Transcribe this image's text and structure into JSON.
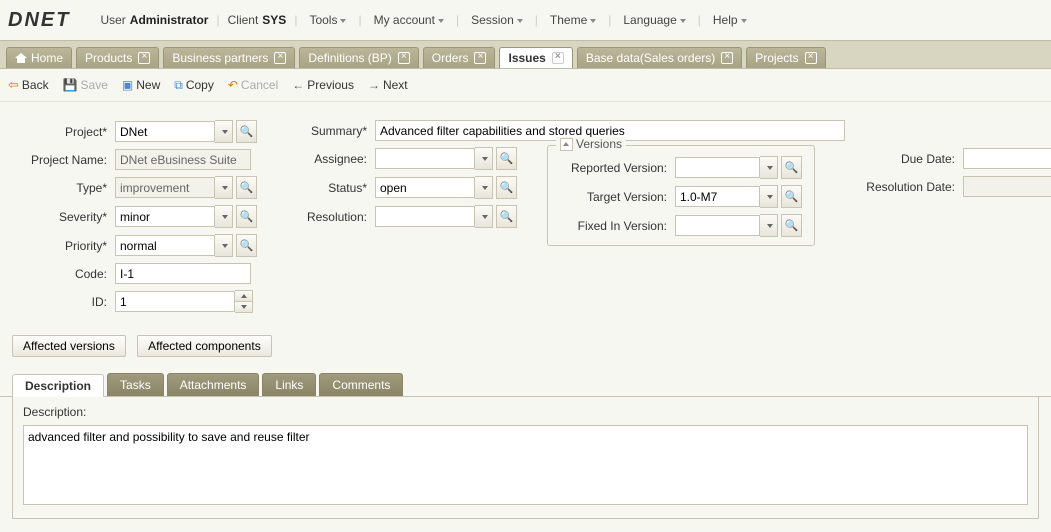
{
  "header": {
    "logo": "DNET",
    "user_label": "User",
    "user_value": "Administrator",
    "client_label": "Client",
    "client_value": "SYS",
    "menus": [
      "Tools",
      "My account",
      "Session",
      "Theme",
      "Language",
      "Help"
    ]
  },
  "main_tabs": [
    {
      "label": "Home",
      "closable": false,
      "active": false
    },
    {
      "label": "Products",
      "closable": true,
      "active": false
    },
    {
      "label": "Business partners",
      "closable": true,
      "active": false
    },
    {
      "label": "Definitions (BP)",
      "closable": true,
      "active": false
    },
    {
      "label": "Orders",
      "closable": true,
      "active": false
    },
    {
      "label": "Issues",
      "closable": true,
      "active": true
    },
    {
      "label": "Base data(Sales orders)",
      "closable": true,
      "active": false
    },
    {
      "label": "Projects",
      "closable": true,
      "active": false
    }
  ],
  "toolbar": {
    "back": "Back",
    "save": "Save",
    "new": "New",
    "copy": "Copy",
    "cancel": "Cancel",
    "previous": "Previous",
    "next": "Next"
  },
  "form": {
    "project_label": "Project*",
    "project_value": "DNet",
    "project_name_label": "Project Name:",
    "project_name_value": "DNet eBusiness Suite",
    "type_label": "Type*",
    "type_value": "improvement",
    "severity_label": "Severity*",
    "severity_value": "minor",
    "priority_label": "Priority*",
    "priority_value": "normal",
    "code_label": "Code:",
    "code_value": "I-1",
    "id_label": "ID:",
    "id_value": "1",
    "summary_label": "Summary*",
    "summary_value": "Advanced filter capabilities and stored queries",
    "assignee_label": "Assignee:",
    "assignee_value": "",
    "status_label": "Status*",
    "status_value": "open",
    "resolution_label": "Resolution:",
    "resolution_value": "",
    "versions_legend": "Versions",
    "reported_version_label": "Reported Version:",
    "reported_version_value": "",
    "target_version_label": "Target Version:",
    "target_version_value": "1.0-M7",
    "fixed_version_label": "Fixed In Version:",
    "fixed_version_value": "",
    "due_date_label": "Due Date:",
    "due_date_value": "",
    "resolution_date_label": "Resolution Date:",
    "resolution_date_value": ""
  },
  "buttons": {
    "affected_versions": "Affected versions",
    "affected_components": "Affected components"
  },
  "sub_tabs": [
    "Description",
    "Tasks",
    "Attachments",
    "Links",
    "Comments"
  ],
  "description": {
    "label": "Description:",
    "value": "advanced filter and possibility to save and reuse filter"
  }
}
